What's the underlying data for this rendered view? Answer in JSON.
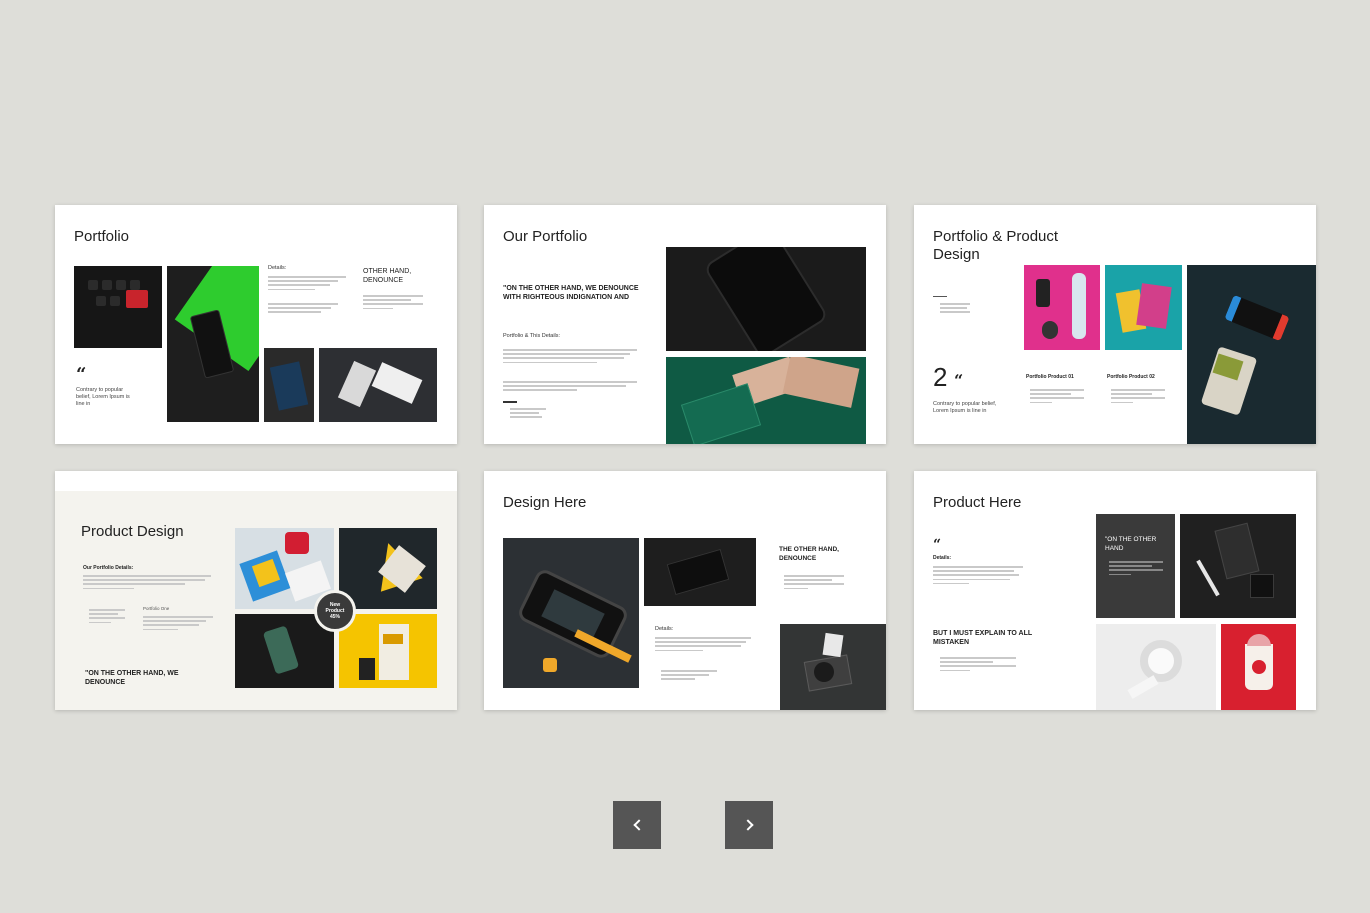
{
  "slides": [
    {
      "title": "Portfolio",
      "details_label": "Details:",
      "heading": "OTHER HAND, DENOUNCE",
      "quote_mark": "“",
      "quote_text": "Contrary to popular belief, Lorem Ipsum is line in"
    },
    {
      "title": "Our  Portfolio",
      "quote": "\"ON THE OTHER HAND, WE DENOUNCE WITH RIGHTEOUS INDIGNATION AND",
      "details_label": "Portfolio & This Details:"
    },
    {
      "title": "Portfolio & Product Design",
      "number": "2",
      "quote_mark": "“",
      "quote_text": "Contrary to popular belief, Lorem Ipsum is line in",
      "product1": "Portfolio Product 01",
      "product2": "Portfolio Product 02"
    },
    {
      "title": "Product Design",
      "details_label": "Our Portfolio Details:",
      "sub_label": "Portfolio One",
      "quote": "\"ON THE OTHER HAND, WE DENOUNCE",
      "badge_line1": "New",
      "badge_line2": "Product",
      "badge_line3": "45%"
    },
    {
      "title": "Design Here",
      "heading": "THE OTHER HAND, DENOUNCE",
      "details_label": "Details:"
    },
    {
      "title": "Product Here",
      "quote_mark": "“",
      "details_label": "Details:",
      "heading": "BUT I MUST EXPLAIN TO ALL MISTAKEN",
      "dark_quote": "\"ON THE OTHER HAND"
    }
  ],
  "navigation": {
    "prev": "previous",
    "next": "next"
  },
  "colors": {
    "background": "#deded9",
    "button": "#555555",
    "accent_green": "#2ecc2e",
    "accent_magenta": "#e0308c",
    "accent_teal": "#1aa3a8",
    "accent_yellow": "#f5c400",
    "accent_red": "#d8202f",
    "deep_green": "#0f5a44"
  }
}
